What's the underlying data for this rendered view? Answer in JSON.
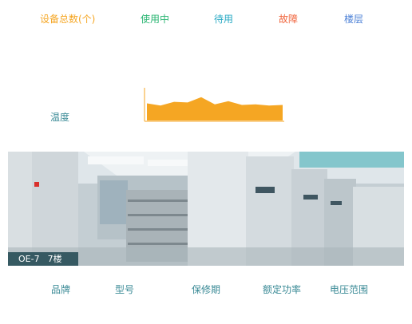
{
  "stats": {
    "total_label": "设备总数(个)",
    "in_use_label": "使用中",
    "standby_label": "待用",
    "fault_label": "故障",
    "floor_label": "楼层"
  },
  "temperature": {
    "label": "温度",
    "series_color": "#f5a623",
    "chart_data": {
      "type": "area",
      "values": [
        55,
        48,
        60,
        58,
        75,
        52,
        62,
        50,
        52,
        48,
        50
      ]
    }
  },
  "device_photo": {
    "code": "OE-7",
    "floor": "7楼"
  },
  "properties": {
    "brand_label": "品牌",
    "model_label": "型号",
    "warranty_label": "保修期",
    "rated_power_label": "额定功率",
    "voltage_range_label": "电压范围"
  }
}
